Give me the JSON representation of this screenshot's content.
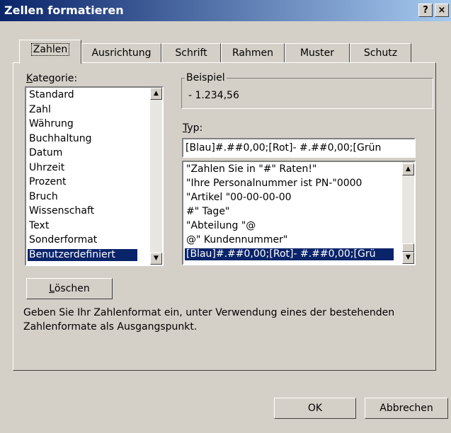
{
  "window": {
    "title": "Zellen formatieren",
    "help_label": "?",
    "close_label": "×"
  },
  "tabs": [
    {
      "label": "Zahlen"
    },
    {
      "label": "Ausrichtung"
    },
    {
      "label": "Schrift"
    },
    {
      "label": "Rahmen"
    },
    {
      "label": "Muster"
    },
    {
      "label": "Schutz"
    }
  ],
  "category": {
    "label": "Kategorie:",
    "items": [
      "Standard",
      "Zahl",
      "Währung",
      "Buchhaltung",
      "Datum",
      "Uhrzeit",
      "Prozent",
      "Bruch",
      "Wissenschaft",
      "Text",
      "Sonderformat",
      "Benutzerdefiniert"
    ],
    "selected": "Benutzerdefiniert"
  },
  "sample": {
    "label": "Beispiel",
    "value": "- 1.234,56"
  },
  "type": {
    "label": "Typ:",
    "value": "[Blau]#.##0,00;[Rot]- #.##0,00;[Grün",
    "items": [
      "\"Zahlen Sie in \"#\" Raten!\"",
      "\"Ihre Personalnummer ist PN-\"0000",
      "\"Artikel \"00-00-00-00",
      "#\" Tage\"",
      "\"Abteilung \"@",
      "@\" Kundennummer\"",
      "[Blau]#.##0,00;[Rot]- #.##0,00;[Grü"
    ]
  },
  "buttons": {
    "delete": "Löschen",
    "ok": "OK",
    "cancel": "Abbrechen"
  },
  "description": "Geben Sie Ihr Zahlenformat ein, unter Verwendung eines der bestehenden Zahlenformate als Ausgangspunkt."
}
